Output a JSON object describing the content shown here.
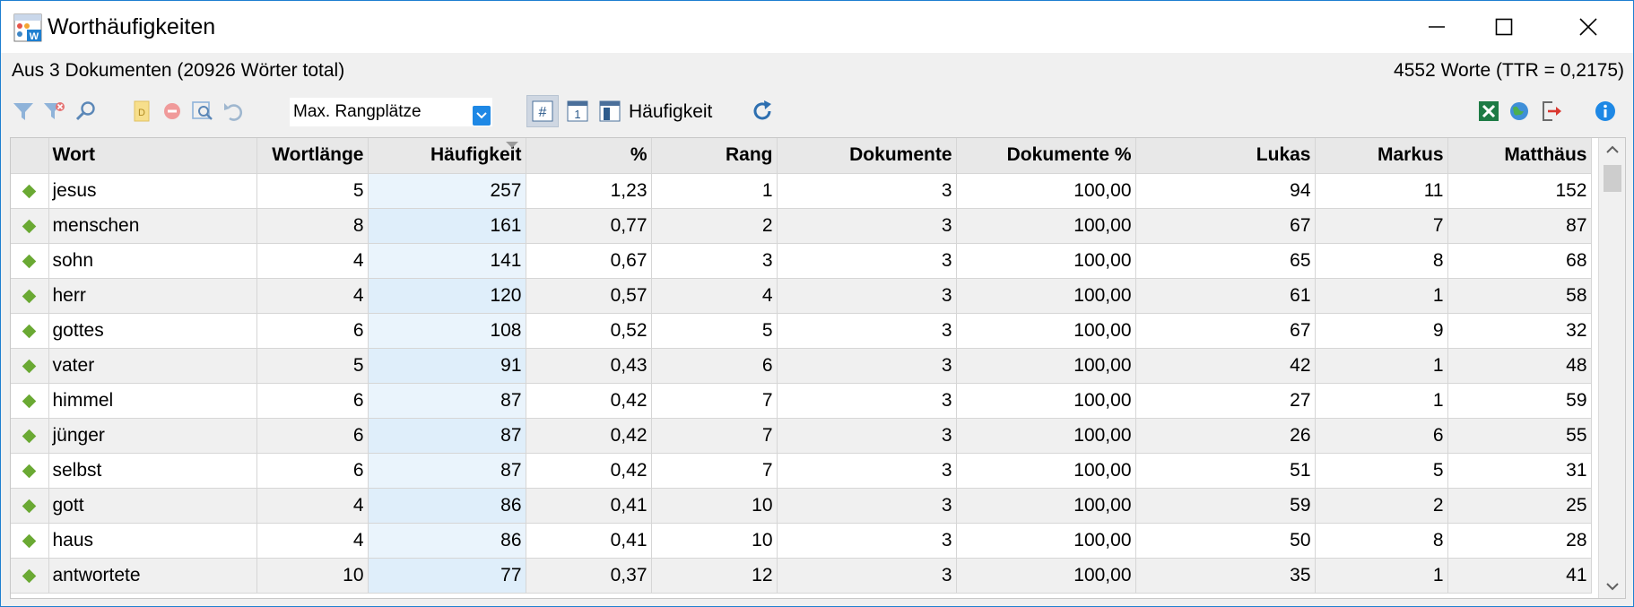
{
  "window": {
    "title": "Worthäufigkeiten"
  },
  "info": {
    "left": "Aus 3 Dokumenten (20926 Wörter total)",
    "right": "4552 Worte (TTR = 0,2175)"
  },
  "toolbar": {
    "combo_value": "Max. Rangplätze",
    "label": "Häufigkeit",
    "icons": [
      "filter-icon",
      "filter-remove-icon",
      "search-icon",
      "document-icon",
      "stop-icon",
      "preview-icon",
      "undo-icon",
      "hash-icon",
      "one-icon",
      "column-icon",
      "refresh-icon",
      "excel-icon",
      "globe-icon",
      "export-icon",
      "info-icon"
    ]
  },
  "table": {
    "columns": [
      "",
      "Wort",
      "Wortlänge",
      "Häufigkeit",
      "%",
      "Rang",
      "Dokumente",
      "Dokumente %",
      "Lukas",
      "Markus",
      "Matthäus"
    ],
    "sorted_column": "Häufigkeit",
    "rows": [
      [
        "jesus",
        "5",
        "257",
        "1,23",
        "1",
        "3",
        "100,00",
        "94",
        "11",
        "152"
      ],
      [
        "menschen",
        "8",
        "161",
        "0,77",
        "2",
        "3",
        "100,00",
        "67",
        "7",
        "87"
      ],
      [
        "sohn",
        "4",
        "141",
        "0,67",
        "3",
        "3",
        "100,00",
        "65",
        "8",
        "68"
      ],
      [
        "herr",
        "4",
        "120",
        "0,57",
        "4",
        "3",
        "100,00",
        "61",
        "1",
        "58"
      ],
      [
        "gottes",
        "6",
        "108",
        "0,52",
        "5",
        "3",
        "100,00",
        "67",
        "9",
        "32"
      ],
      [
        "vater",
        "5",
        "91",
        "0,43",
        "6",
        "3",
        "100,00",
        "42",
        "1",
        "48"
      ],
      [
        "himmel",
        "6",
        "87",
        "0,42",
        "7",
        "3",
        "100,00",
        "27",
        "1",
        "59"
      ],
      [
        "jünger",
        "6",
        "87",
        "0,42",
        "7",
        "3",
        "100,00",
        "26",
        "6",
        "55"
      ],
      [
        "selbst",
        "6",
        "87",
        "0,42",
        "7",
        "3",
        "100,00",
        "51",
        "5",
        "31"
      ],
      [
        "gott",
        "4",
        "86",
        "0,41",
        "10",
        "3",
        "100,00",
        "59",
        "2",
        "25"
      ],
      [
        "haus",
        "4",
        "86",
        "0,41",
        "10",
        "3",
        "100,00",
        "50",
        "8",
        "28"
      ],
      [
        "antwortete",
        "10",
        "77",
        "0,37",
        "12",
        "3",
        "100,00",
        "35",
        "1",
        "41"
      ]
    ]
  },
  "colors": {
    "accent": "#1e7fd0",
    "marker": "#6aa933",
    "sorted_column_bg": "#eaf4fc"
  }
}
